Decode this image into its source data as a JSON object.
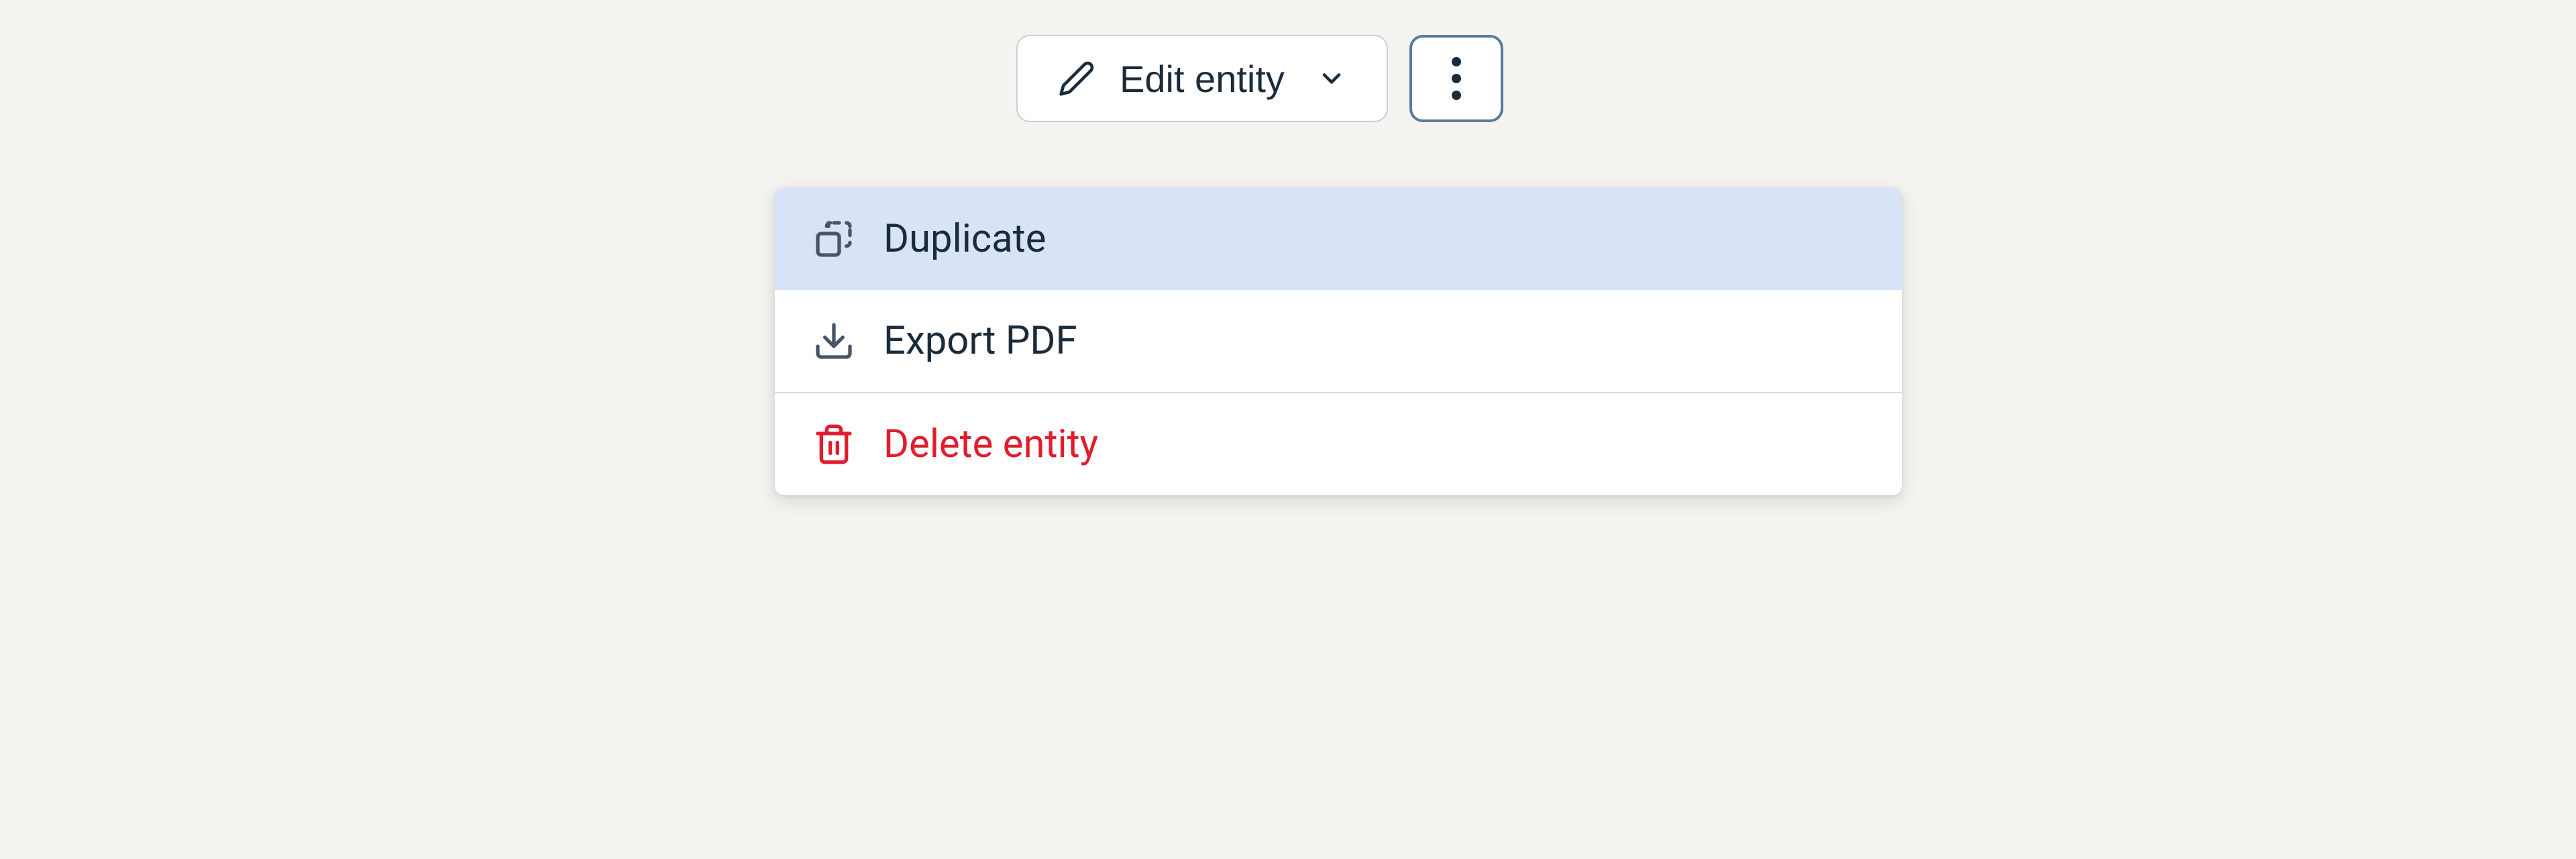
{
  "toolbar": {
    "edit_label": "Edit entity"
  },
  "menu": {
    "items": [
      {
        "label": "Duplicate",
        "icon": "duplicate-icon",
        "highlighted": true,
        "danger": false
      },
      {
        "label": "Export PDF",
        "icon": "download-icon",
        "highlighted": false,
        "danger": false
      },
      {
        "label": "Delete entity",
        "icon": "trash-icon",
        "highlighted": false,
        "danger": true
      }
    ]
  }
}
